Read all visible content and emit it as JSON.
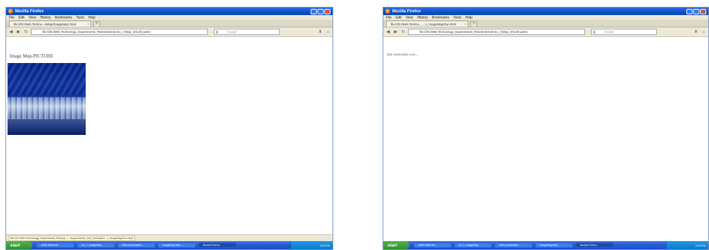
{
  "left": {
    "window_title": "Mozilla Firefox",
    "menu": [
      "File",
      "Edit",
      "View",
      "History",
      "Bookmarks",
      "Tools",
      "Help"
    ],
    "tab_label": "file:///D:/Web Techno...4Map/ImageMap1.html",
    "url": "file:///D:/Web Technology_Experiments_Rises/Internet Ex_I (Map_20120) part4",
    "search_placeholder": "Google",
    "page_heading": "Image Map-PICTURE",
    "status_text": "file:///D:/Web Technology_Experiments_Rises/p.../.../experiments_Ex6_FullmapEx...1_ImageMap/Sun.html",
    "start_label": "start",
    "taskbar_items": [
      "WEB MANUAL",
      "Ex_1_ImageMap",
      "Web-Automation ...",
      "ImageMap.html - ...",
      "Mozilla Firefox"
    ],
    "clock": "3:02 PM"
  },
  "right": {
    "window_title": "Mozilla Firefox",
    "menu": [
      "File",
      "Edit",
      "View",
      "History",
      "Bookmarks",
      "Tools",
      "Help"
    ],
    "tab_label": "file:///D:/Web Techno... ...1_ImageMap/Sun.html",
    "url": "file:///D:/Web Technology_Experiments_Rises/Internet Ex_I (Map_20120) part4",
    "search_placeholder": "Google",
    "page_text": "Sun welcomes you....",
    "start_label": "start",
    "taskbar_items": [
      "WEB MANUAL",
      "Ex_1_ImageMap",
      "Web-Automation ...",
      "ImageMap.html - ...",
      "Mozilla Firefox"
    ],
    "clock": "3:03 PM"
  }
}
